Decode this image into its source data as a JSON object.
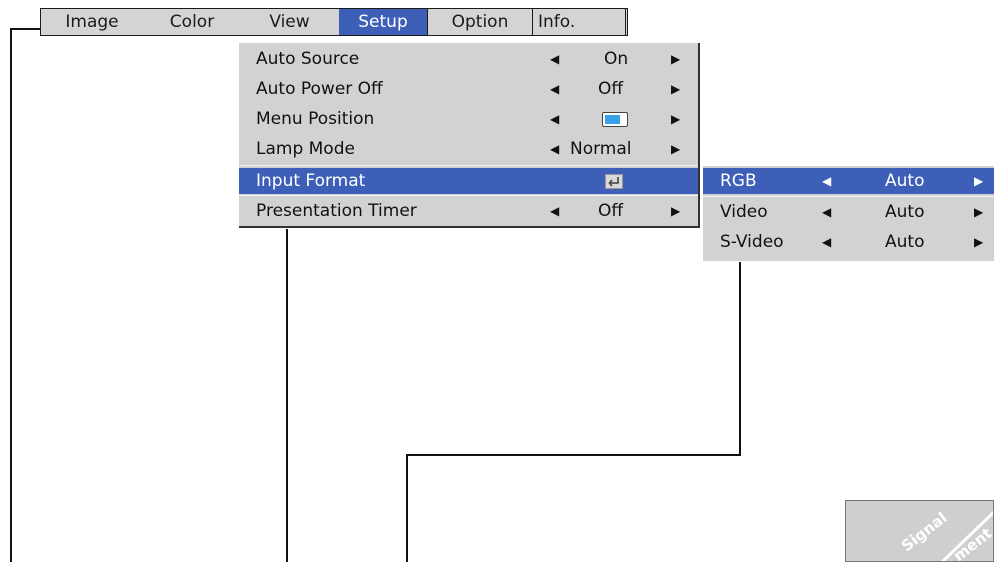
{
  "menu_tabs": [
    {
      "label": "Image",
      "selected": false
    },
    {
      "label": "Color",
      "selected": false
    },
    {
      "label": "View",
      "selected": false
    },
    {
      "label": "Setup",
      "selected": true
    },
    {
      "label": "Option",
      "selected": false
    },
    {
      "label": "Info.",
      "selected": false
    }
  ],
  "setup_menu": {
    "items": [
      {
        "label": "Auto Source",
        "left_arrow": "◀",
        "value": "On",
        "right_arrow": "▶"
      },
      {
        "label": "Auto Power Off",
        "left_arrow": "◀",
        "value": "Off",
        "right_arrow": "▶"
      },
      {
        "label": "Menu Position",
        "left_arrow": "◀",
        "value_icon": "menu-position-icon",
        "right_arrow": "▶"
      },
      {
        "label": "Lamp Mode",
        "left_arrow": "◀",
        "value": "Normal",
        "right_arrow": "▶"
      },
      {
        "label": "Input Format",
        "value_icon": "enter-icon",
        "selected": true
      },
      {
        "label": "Presentation Timer",
        "left_arrow": "◀",
        "value": "Off",
        "right_arrow": "▶"
      }
    ]
  },
  "input_format_submenu": {
    "items": [
      {
        "label": "RGB",
        "left_arrow": "◀",
        "value": "Auto",
        "right_arrow": "▶",
        "selected": true
      },
      {
        "label": "Video",
        "left_arrow": "◀",
        "value": "Auto",
        "right_arrow": "▶"
      },
      {
        "label": "S-Video",
        "left_arrow": "◀",
        "value": "Auto",
        "right_arrow": "▶"
      }
    ]
  },
  "corner_badge": {
    "text_1": "Signal",
    "text_2": "ment"
  },
  "colors": {
    "highlight": "#3d5fb8",
    "panel": "#d2d2d2",
    "menubar": "#d4d4d4"
  }
}
